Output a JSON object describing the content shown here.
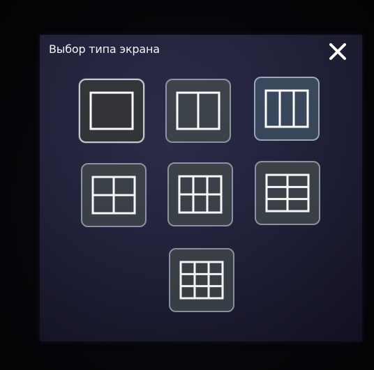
{
  "dialog": {
    "title": "Выбор типа экрана",
    "close_icon": "close-icon",
    "colors": {
      "panel": "#20203a",
      "tile": "#3b4148",
      "tile_selected": "#303236",
      "glyph": "#ffffff"
    }
  },
  "layouts": [
    {
      "name": "layout-1-screen",
      "icon": "single-screen-icon",
      "cols": 1,
      "rows": 1,
      "selected": true
    },
    {
      "name": "layout-2-screens",
      "icon": "two-columns-icon",
      "cols": 2,
      "rows": 1,
      "selected": false
    },
    {
      "name": "layout-3-screens",
      "icon": "three-columns-icon",
      "cols": 3,
      "rows": 1,
      "selected": false
    },
    {
      "name": "layout-4-screens",
      "icon": "grid-2x2-icon",
      "cols": 2,
      "rows": 2,
      "selected": false
    },
    {
      "name": "layout-6-screens-3x2",
      "icon": "grid-3x2-icon",
      "cols": 3,
      "rows": 2,
      "selected": false
    },
    {
      "name": "layout-6-screens-2x3",
      "icon": "grid-2x3-icon",
      "cols": 2,
      "rows": 3,
      "selected": false
    },
    {
      "name": "layout-9-screens",
      "icon": "grid-3x3-icon",
      "cols": 3,
      "rows": 3,
      "selected": false
    }
  ]
}
